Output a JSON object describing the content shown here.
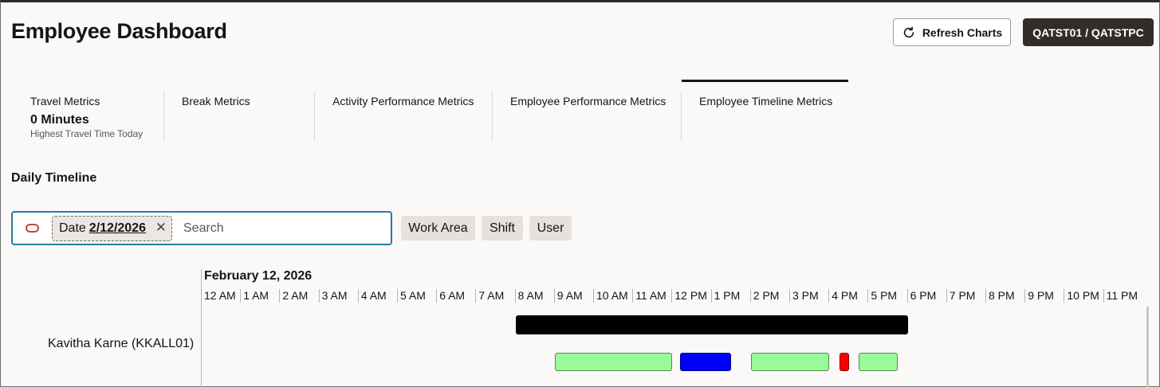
{
  "header": {
    "title": "Employee Dashboard",
    "refresh_label": "Refresh Charts",
    "user_label": "QATST01 / QATSTPC"
  },
  "tabs": [
    {
      "label": "Travel Metrics",
      "value": "0 Minutes",
      "subtitle": "Highest Travel Time Today",
      "active": false
    },
    {
      "label": "Break Metrics",
      "active": false
    },
    {
      "label": "Activity Performance Metrics",
      "active": false
    },
    {
      "label": "Employee Performance Metrics",
      "active": false
    },
    {
      "label": "Employee Timeline Metrics",
      "active": true
    }
  ],
  "daily_timeline": {
    "title": "Daily Timeline",
    "search": {
      "chip_label": "Date",
      "chip_value": "2/12/2026",
      "placeholder": "Search"
    },
    "filters": [
      "Work Area",
      "Shift",
      "User"
    ]
  },
  "timeline": {
    "date_label": "February 12, 2026",
    "hours": [
      "12 AM",
      "1 AM",
      "2 AM",
      "3 AM",
      "4 AM",
      "5 AM",
      "6 AM",
      "7 AM",
      "8 AM",
      "9 AM",
      "10 AM",
      "11 AM",
      "12 PM",
      "1 PM",
      "2 PM",
      "3 PM",
      "4 PM",
      "5 PM",
      "6 PM",
      "7 PM",
      "8 PM",
      "9 PM",
      "10 PM",
      "11 PM"
    ],
    "rows": [
      {
        "employee": "Kavitha Karne (KKALL01)",
        "shift_bar": {
          "start": 8.0,
          "end": 18.0,
          "color": "#000000"
        },
        "activities": [
          {
            "start": 9.0,
            "end": 12.0,
            "color": "#98fb98"
          },
          {
            "start": 12.2,
            "end": 13.5,
            "color": "#0000ff"
          },
          {
            "start": 14.0,
            "end": 16.0,
            "color": "#98fb98"
          },
          {
            "start": 16.25,
            "end": 16.5,
            "color": "#ff0000"
          },
          {
            "start": 16.75,
            "end": 17.75,
            "color": "#98fb98"
          }
        ]
      }
    ]
  },
  "colors": {
    "focus_border": "#227e9e",
    "primary_dark": "#312d2a",
    "accent_red": "#c74634"
  }
}
